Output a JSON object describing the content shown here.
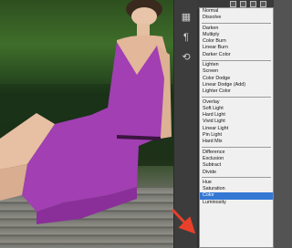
{
  "blend_menu": {
    "groups": [
      [
        {
          "label": "Normal"
        },
        {
          "label": "Dissolve"
        }
      ],
      [
        {
          "label": "Darken"
        },
        {
          "label": "Multiply"
        },
        {
          "label": "Color Burn"
        },
        {
          "label": "Linear Burn"
        },
        {
          "label": "Darker Color"
        }
      ],
      [
        {
          "label": "Lighten"
        },
        {
          "label": "Screen"
        },
        {
          "label": "Color Dodge"
        },
        {
          "label": "Linear Dodge (Add)"
        },
        {
          "label": "Lighter Color"
        }
      ],
      [
        {
          "label": "Overlay"
        },
        {
          "label": "Soft Light"
        },
        {
          "label": "Hard Light"
        },
        {
          "label": "Vivid Light"
        },
        {
          "label": "Linear Light"
        },
        {
          "label": "Pin Light"
        },
        {
          "label": "Hard Mix"
        }
      ],
      [
        {
          "label": "Difference"
        },
        {
          "label": "Exclusion"
        },
        {
          "label": "Subtract"
        },
        {
          "label": "Divide"
        }
      ],
      [
        {
          "label": "Hue"
        },
        {
          "label": "Saturation"
        },
        {
          "label": "Color",
          "selected": true
        },
        {
          "label": "Luminosity"
        }
      ]
    ]
  },
  "colors": {
    "selection": "#3478d4",
    "dress": "#a23fb3",
    "arrow": "#e8402a"
  },
  "tools": [
    {
      "icon": "grid-icon"
    },
    {
      "icon": "paragraph-icon"
    },
    {
      "icon": "history-icon"
    }
  ]
}
